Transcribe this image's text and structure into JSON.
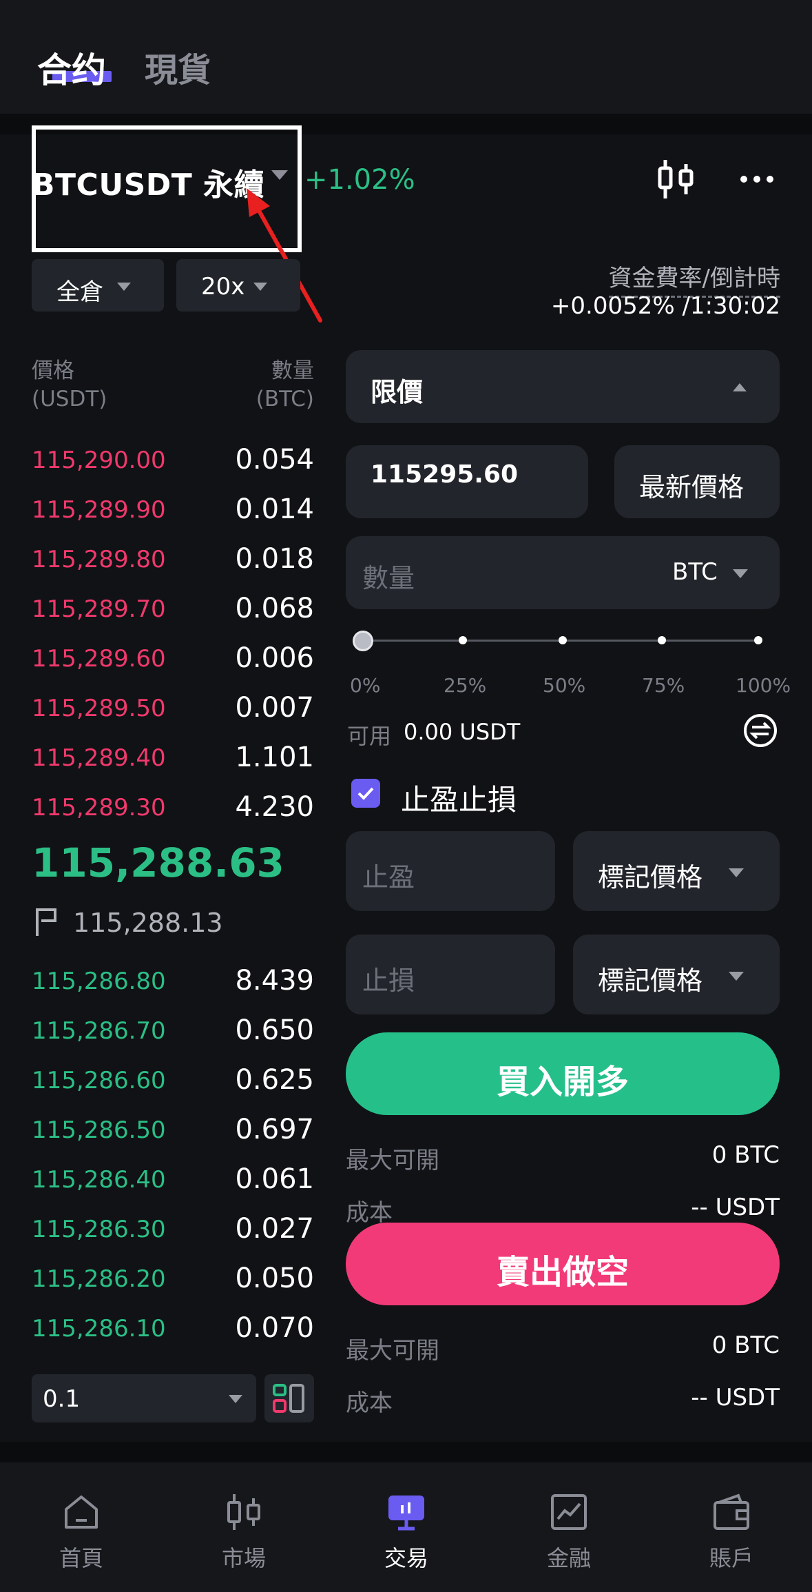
{
  "tabs": {
    "contract": "合约",
    "spot": "現貨"
  },
  "symbol": {
    "name": "BTCUSDT 永續",
    "change": "+1.02%"
  },
  "margin_mode": "全倉",
  "leverage": "20x",
  "funding": {
    "title": "資金費率/倒計時",
    "value": "+0.0052% /1:30:02"
  },
  "orderbook": {
    "price_header": "價格",
    "price_unit": "(USDT)",
    "qty_header": "數量",
    "qty_unit": "(BTC)",
    "asks": [
      {
        "price": "115,290.00",
        "qty": "0.054"
      },
      {
        "price": "115,289.90",
        "qty": "0.014"
      },
      {
        "price": "115,289.80",
        "qty": "0.018"
      },
      {
        "price": "115,289.70",
        "qty": "0.068"
      },
      {
        "price": "115,289.60",
        "qty": "0.006"
      },
      {
        "price": "115,289.50",
        "qty": "0.007"
      },
      {
        "price": "115,289.40",
        "qty": "1.101"
      },
      {
        "price": "115,289.30",
        "qty": "4.230"
      }
    ],
    "last_price": "115,288.63",
    "mark_price": "115,288.13",
    "bids": [
      {
        "price": "115,286.80",
        "qty": "8.439"
      },
      {
        "price": "115,286.70",
        "qty": "0.650"
      },
      {
        "price": "115,286.60",
        "qty": "0.625"
      },
      {
        "price": "115,286.50",
        "qty": "0.697"
      },
      {
        "price": "115,286.40",
        "qty": "0.061"
      },
      {
        "price": "115,286.30",
        "qty": "0.027"
      },
      {
        "price": "115,286.20",
        "qty": "0.050"
      },
      {
        "price": "115,286.10",
        "qty": "0.070"
      }
    ],
    "depth": "0.1"
  },
  "order": {
    "type": "限價",
    "price_value": "115295.60",
    "latest_price_btn": "最新價格",
    "qty_placeholder": "數量",
    "qty_unit": "BTC",
    "slider_labels": [
      "0%",
      "25%",
      "50%",
      "75%",
      "100%"
    ],
    "slider_value": 0,
    "available_label": "可用",
    "available_value": "0.00 USDT",
    "tpsl_label": "止盈止損",
    "tpsl_checked": true,
    "take_profit_placeholder": "止盈",
    "stop_loss_placeholder": "止損",
    "trigger_type": "標記價格",
    "buy_label": "買入開多",
    "sell_label": "賣出做空",
    "max_open_label": "最大可開",
    "max_open_value": "0 BTC",
    "cost_label": "成本",
    "cost_value": "-- USDT"
  },
  "nav": [
    "首頁",
    "市場",
    "交易",
    "金融",
    "賬戶"
  ],
  "colors": {
    "up": "#2bbf86",
    "down": "#f0396c",
    "accent": "#6a5cf0",
    "buy": "#25c08a",
    "sell": "#f23a78"
  }
}
